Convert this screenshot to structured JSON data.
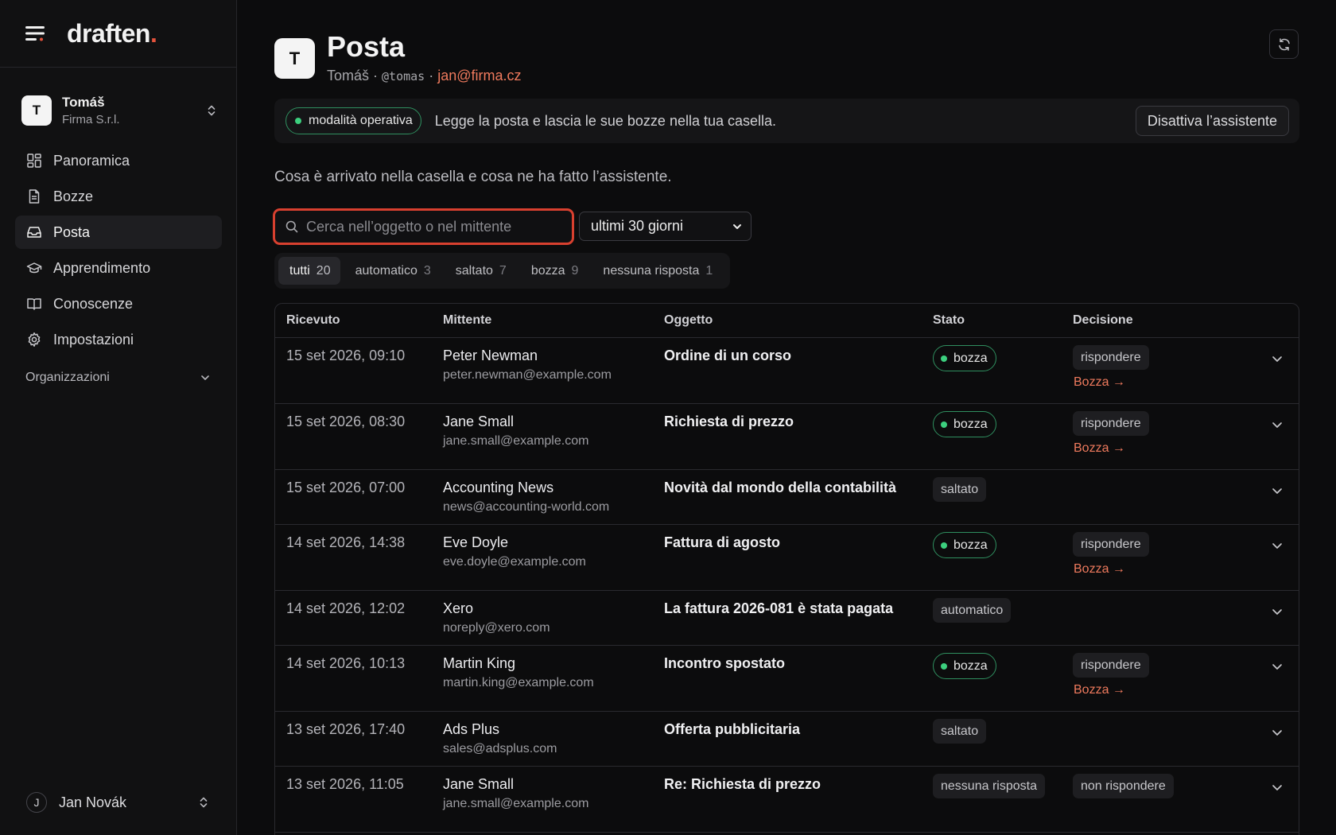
{
  "brand": {
    "name": "draften",
    "dot": "."
  },
  "workspace": {
    "avatar": "T",
    "name": "Tomáš",
    "org": "Firma S.r.l."
  },
  "nav": [
    {
      "label": "Panoramica",
      "icon": "dashboard-icon",
      "active": false
    },
    {
      "label": "Bozze",
      "icon": "document-icon",
      "active": false
    },
    {
      "label": "Posta",
      "icon": "inbox-icon",
      "active": true
    },
    {
      "label": "Apprendimento",
      "icon": "graduation-cap-icon",
      "active": false
    },
    {
      "label": "Conoscenze",
      "icon": "book-icon",
      "active": false
    },
    {
      "label": "Impostazioni",
      "icon": "gear-icon",
      "active": false
    }
  ],
  "organizations_label": "Organizzazioni",
  "user": {
    "avatar": "J",
    "name": "Jan Novák"
  },
  "header": {
    "avatar": "T",
    "title": "Posta",
    "name": "Tomáš",
    "sep1": " · ",
    "handle": "@tomas",
    "sep2": " · ",
    "email": "jan@firma.cz"
  },
  "banner": {
    "mode": "modalità operativa",
    "text": "Legge la posta e lascia le sue bozze nella tua casella.",
    "button": "Disattiva l’assistente"
  },
  "description": "Cosa è arrivato nella casella e cosa ne ha fatto l’assistente.",
  "search": {
    "placeholder": "Cerca nell’oggetto o nel mittente",
    "value": ""
  },
  "period": {
    "selected": "ultimi 30 giorni"
  },
  "filters": [
    {
      "label": "tutti",
      "count": "20",
      "active": true
    },
    {
      "label": "automatico",
      "count": "3",
      "active": false
    },
    {
      "label": "saltato",
      "count": "7",
      "active": false
    },
    {
      "label": "bozza",
      "count": "9",
      "active": false
    },
    {
      "label": "nessuna risposta",
      "count": "1",
      "active": false
    }
  ],
  "table": {
    "columns": {
      "received": "Ricevuto",
      "sender": "Mittente",
      "subject": "Oggetto",
      "state": "Stato",
      "decision": "Decisione"
    },
    "rows": [
      {
        "received": "15 set 2026, 09:10",
        "name": "Peter Newman",
        "email": "peter.newman@example.com",
        "subject": "Ordine di un corso",
        "state": "bozza",
        "state_type": "draft",
        "decision": "rispondere",
        "link": "Bozza →"
      },
      {
        "received": "15 set 2026, 08:30",
        "name": "Jane Small",
        "email": "jane.small@example.com",
        "subject": "Richiesta di prezzo",
        "state": "bozza",
        "state_type": "draft",
        "decision": "rispondere",
        "link": "Bozza →"
      },
      {
        "received": "15 set 2026, 07:00",
        "name": "Accounting News",
        "email": "news@accounting-world.com",
        "subject": "Novità dal mondo della contabilità",
        "state": "saltato",
        "state_type": "gray",
        "decision": "",
        "link": ""
      },
      {
        "received": "14 set 2026, 14:38",
        "name": "Eve Doyle",
        "email": "eve.doyle@example.com",
        "subject": "Fattura di agosto",
        "state": "bozza",
        "state_type": "draft",
        "decision": "rispondere",
        "link": "Bozza →"
      },
      {
        "received": "14 set 2026, 12:02",
        "name": "Xero",
        "email": "noreply@xero.com",
        "subject": "La fattura 2026-081 è stata pagata",
        "state": "automatico",
        "state_type": "gray",
        "decision": "",
        "link": ""
      },
      {
        "received": "14 set 2026, 10:13",
        "name": "Martin King",
        "email": "martin.king@example.com",
        "subject": "Incontro spostato",
        "state": "bozza",
        "state_type": "draft",
        "decision": "rispondere",
        "link": "Bozza →"
      },
      {
        "received": "13 set 2026, 17:40",
        "name": "Ads Plus",
        "email": "sales@adsplus.com",
        "subject": "Offerta pubblicitaria",
        "state": "saltato",
        "state_type": "gray",
        "decision": "",
        "link": ""
      },
      {
        "received": "13 set 2026, 11:05",
        "name": "Jane Small",
        "email": "jane.small@example.com",
        "subject": "Re: Richiesta di prezzo",
        "state": "nessuna risposta",
        "state_type": "gray",
        "decision": "non rispondere",
        "link": ""
      }
    ]
  },
  "colors": {
    "accent": "#e5533c",
    "link": "#ef7a5d",
    "success": "#3ccf7e",
    "focus": "#d8402f",
    "background": "#0c0c0d"
  }
}
